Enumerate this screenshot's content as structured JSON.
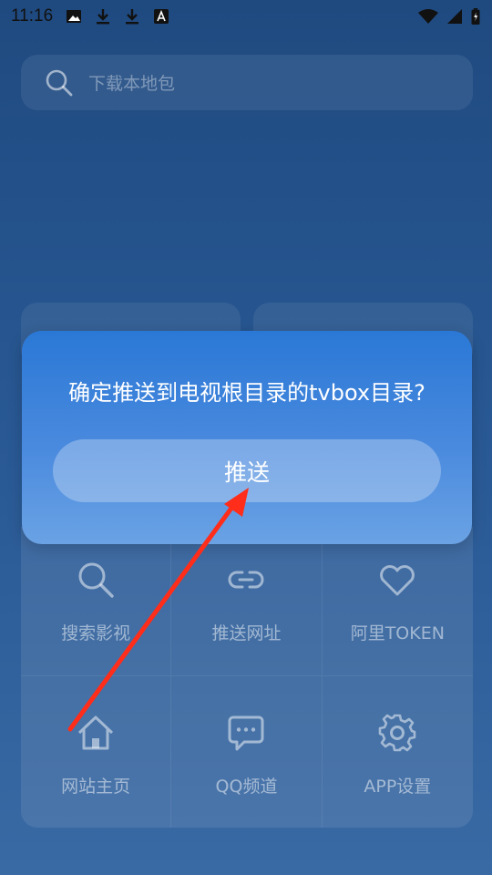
{
  "status_bar": {
    "time": "11:16",
    "left_icons": [
      "image-icon",
      "download-icon",
      "download-icon",
      "text-a-icon"
    ],
    "right_icons": [
      "wifi-icon",
      "signal-icon",
      "battery-icon"
    ]
  },
  "search": {
    "placeholder": "下载本地包"
  },
  "dialog": {
    "message": "确定推送到电视根目录的tvbox目录?",
    "push_label": "推送"
  },
  "grid": {
    "items": [
      {
        "label": "搜索影视",
        "icon": "search-icon"
      },
      {
        "label": "推送网址",
        "icon": "link-icon"
      },
      {
        "label": "阿里TOKEN",
        "icon": "heart-icon"
      },
      {
        "label": "网站主页",
        "icon": "home-icon"
      },
      {
        "label": "QQ频道",
        "icon": "chat-bubble-icon"
      },
      {
        "label": "APP设置",
        "icon": "gear-icon"
      }
    ]
  },
  "colors": {
    "background_top": "#1f4a80",
    "dialog_top": "#2a78d6",
    "dialog_bottom": "#6aa2e4",
    "annotation_arrow": "#ff2d1a"
  }
}
